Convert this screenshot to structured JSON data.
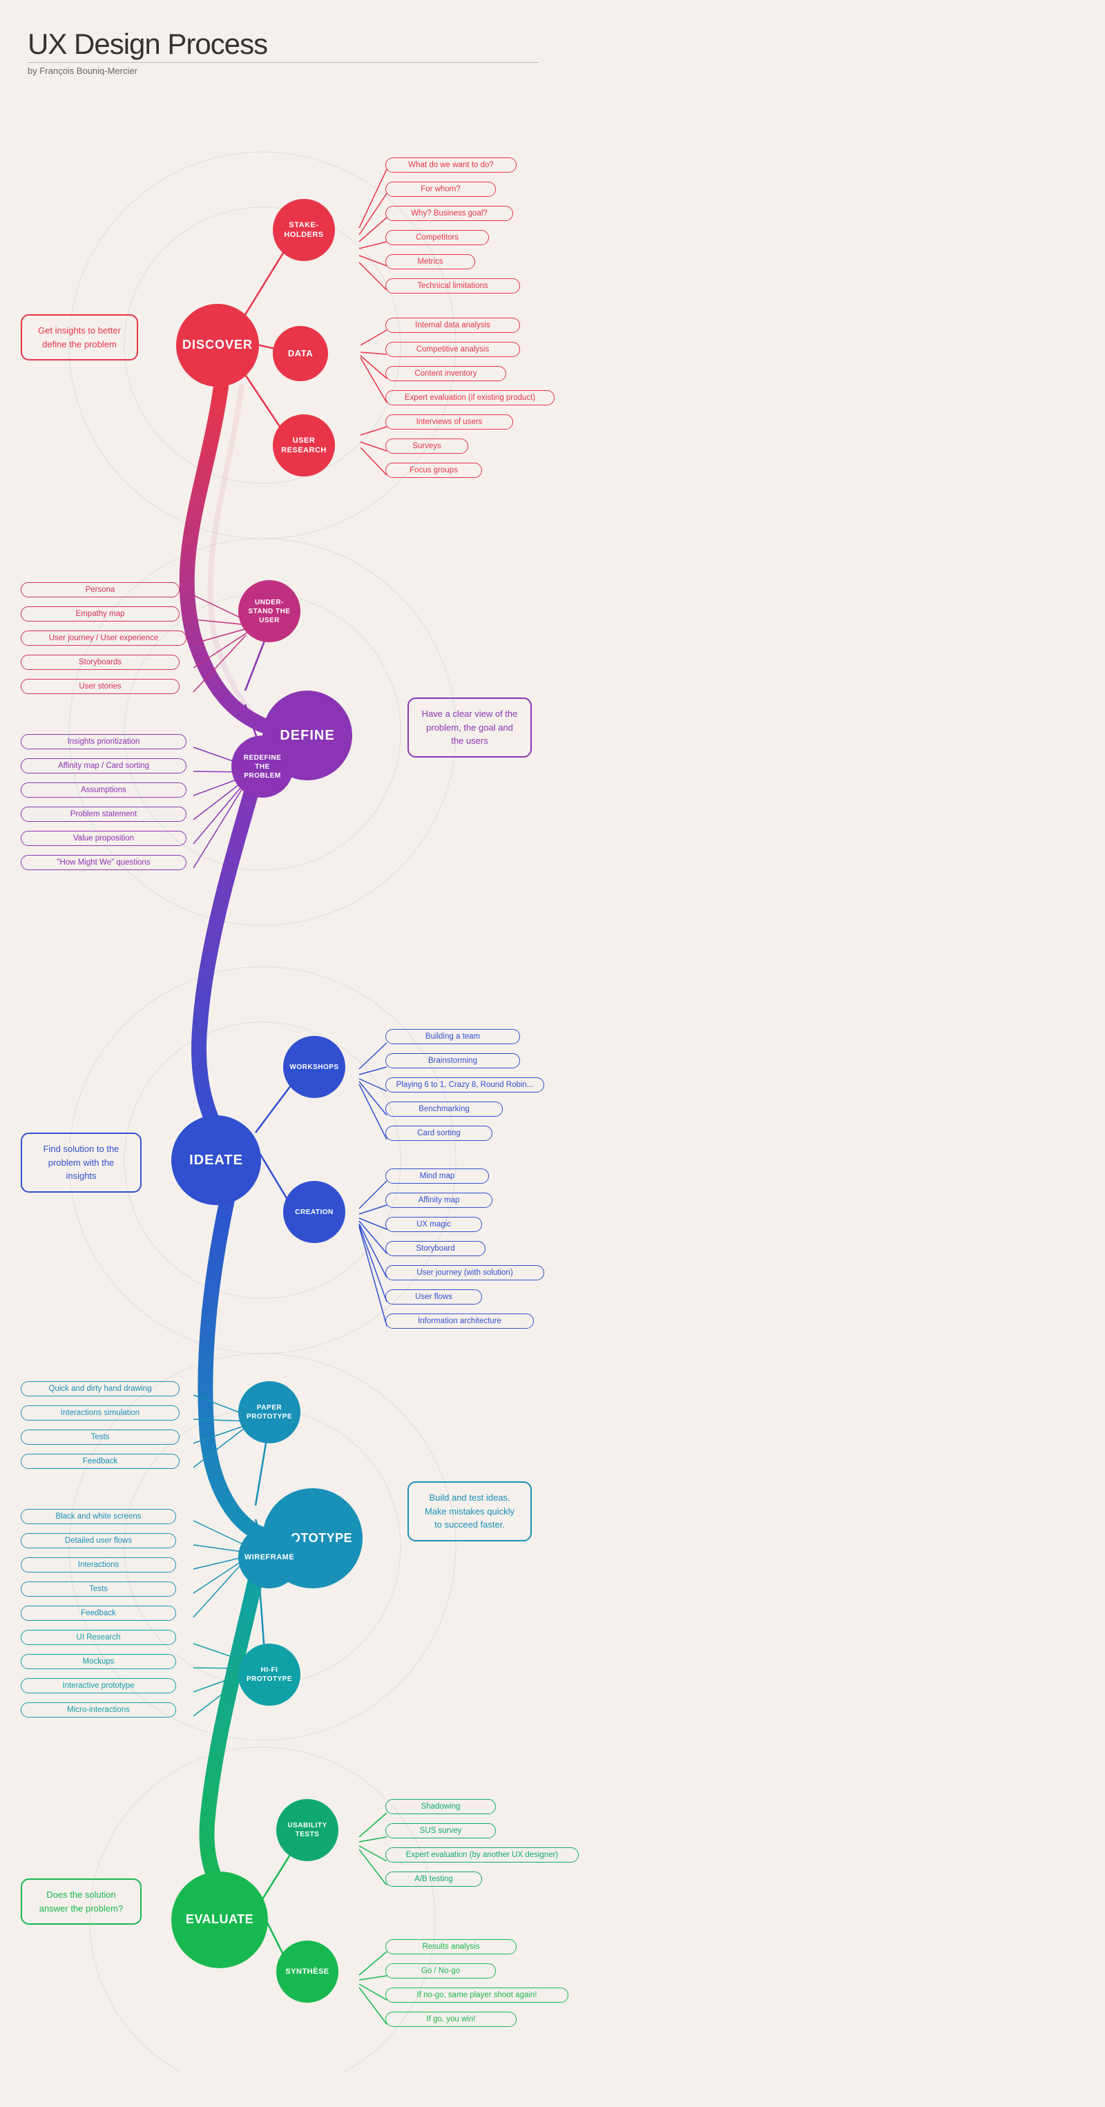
{
  "title": "UX Design Process",
  "subtitle": "by François Bouniq-Mercier",
  "phases": {
    "discover": {
      "label": "DISCOVER",
      "desc": "Get insights to better define the problem",
      "nodes": {
        "stakeholders": {
          "label": "Stake-\nholders",
          "tags": [
            "What do we want to do?",
            "For whom?",
            "Why? Business goal?",
            "Competitors",
            "Metrics",
            "Technical limitations"
          ]
        },
        "data": {
          "label": "Data",
          "tags": [
            "Internal data analysis",
            "Competitive analysis",
            "Content inventory",
            "Expert evaluation (if existing product)"
          ]
        },
        "user_research": {
          "label": "User\nresearch",
          "tags": [
            "Interviews of users",
            "Surveys",
            "Focus groups"
          ]
        }
      }
    },
    "define": {
      "label": "DEFINE",
      "desc": "Have a clear view of the problem, the goal and the users",
      "nodes": {
        "understand": {
          "label": "Under-\nstand the\nuser",
          "tags": [
            "Persona",
            "Empathy map",
            "User journey / User experience",
            "Storyboards",
            "User stories"
          ]
        },
        "redefine": {
          "label": "Redefine\nthe\nproblem",
          "tags": [
            "Insights prioritization",
            "Affinity map / Card sorting",
            "Assumptions",
            "Problem statement",
            "Value proposition",
            "\"How Might We\" questions"
          ]
        }
      }
    },
    "ideate": {
      "label": "IDEATE",
      "desc": "Find solution to the problem with the insights",
      "nodes": {
        "workshops": {
          "label": "Workshops",
          "tags": [
            "Building a team",
            "Brainstorming",
            "Playing 6 to 1, Crazy 8, Round Robin...",
            "Benchmarking",
            "Card sorting"
          ]
        },
        "creation": {
          "label": "Creation",
          "tags": [
            "Mind map",
            "Affinity map",
            "UX magic",
            "Storyboard",
            "User journey (with solution)",
            "User flows",
            "Information architecture"
          ]
        }
      }
    },
    "prototype": {
      "label": "PROTOTYPE",
      "desc": "Build and test ideas. Make mistakes quickly to succeed faster.",
      "nodes": {
        "paper": {
          "label": "Paper\nprototype",
          "tags": [
            "Quick and dirty hand drawing",
            "Interactions simulation",
            "Tests",
            "Feedback"
          ]
        },
        "wireframe": {
          "label": "Wireframe",
          "tags": [
            "Black and white screens",
            "Detailed user flows",
            "Interactions",
            "Tests",
            "Feedback"
          ]
        },
        "hifi": {
          "label": "Hi-Fi\nprototype",
          "tags": [
            "UI Research",
            "Mockups",
            "Interactive prototype",
            "Micro-interactions"
          ]
        }
      }
    },
    "evaluate": {
      "label": "EVALUATE",
      "desc": "Does the solution answer the problem?",
      "nodes": {
        "usability": {
          "label": "Usability\ntests",
          "tags": [
            "Shadowing",
            "SUS survey",
            "Expert evaluation (by another UX designer)",
            "A/B testing"
          ]
        },
        "synthese": {
          "label": "Synthèse",
          "tags": [
            "Results analysis",
            "Go / No-go",
            "If no-go, same player shoot again!",
            "If go, you win!"
          ]
        }
      }
    }
  }
}
